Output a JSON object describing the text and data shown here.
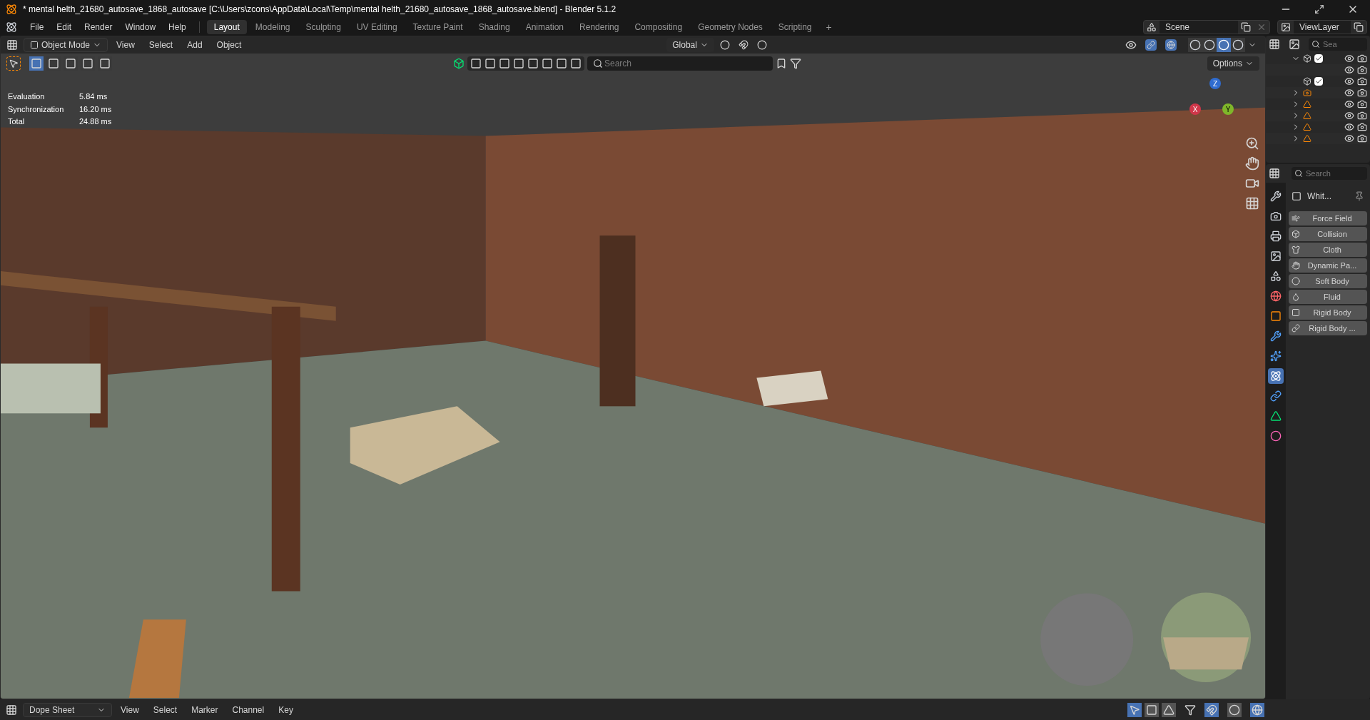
{
  "window": {
    "title": "* mental helth_21680_autosave_1868_autosave [C:\\Users\\zcons\\AppData\\Local\\Temp\\mental helth_21680_autosave_1868_autosave.blend] - Blender 5.1.2"
  },
  "menu": [
    "File",
    "Edit",
    "Render",
    "Window",
    "Help"
  ],
  "workspaces": [
    {
      "label": "Layout",
      "selected": true
    },
    {
      "label": "Modeling",
      "selected": false
    },
    {
      "label": "Sculpting",
      "selected": false
    },
    {
      "label": "UV Editing",
      "selected": false
    },
    {
      "label": "Texture Paint",
      "selected": false
    },
    {
      "label": "Shading",
      "selected": false
    },
    {
      "label": "Animation",
      "selected": false
    },
    {
      "label": "Rendering",
      "selected": false
    },
    {
      "label": "Compositing",
      "selected": false
    },
    {
      "label": "Geometry Nodes",
      "selected": false
    },
    {
      "label": "Scripting",
      "selected": false
    }
  ],
  "add_workspace": "+",
  "scene": "Scene",
  "view_layer": "ViewLayer",
  "viewport": {
    "mode": "Object Mode",
    "menus": [
      "View",
      "Select",
      "Add",
      "Object"
    ],
    "orientation": "Global",
    "search": {
      "placeholder": "Search"
    },
    "options": "Options",
    "select_modes": [
      {
        "selected": true
      },
      {
        "selected": false
      },
      {
        "selected": false
      },
      {
        "selected": false
      },
      {
        "selected": false
      }
    ],
    "shading": [
      {
        "selected": false
      },
      {
        "selected": false
      },
      {
        "selected": true
      },
      {
        "selected": false
      }
    ],
    "stats": [
      {
        "label": "Evaluation",
        "value": "5.84 ms"
      },
      {
        "label": "Synchronization",
        "value": "16.20 ms"
      },
      {
        "label": "Total",
        "value": "24.88 ms"
      }
    ],
    "gizmo": [
      "X",
      "Y",
      "Z"
    ]
  },
  "outliner": {
    "search": {
      "placeholder": "Sea"
    },
    "rows": [
      {
        "kind": "collection",
        "expanded": true,
        "checked": true
      },
      {
        "kind": "line"
      },
      {
        "kind": "collection",
        "checked": true
      },
      {
        "kind": "camera",
        "expanded": false
      },
      {
        "kind": "object",
        "expanded": false
      },
      {
        "kind": "object",
        "expanded": false
      },
      {
        "kind": "object",
        "expanded": false
      },
      {
        "kind": "object",
        "expanded": false
      }
    ]
  },
  "properties": {
    "search": {
      "placeholder": "Search"
    },
    "object": "Whit...",
    "tabs": [
      {
        "selected": false
      },
      {
        "selected": false
      },
      {
        "selected": false
      },
      {
        "selected": false
      },
      {
        "selected": false
      },
      {
        "selected": false
      },
      {
        "selected": false
      },
      {
        "selected": false
      },
      {
        "selected": false
      },
      {
        "selected": true
      },
      {
        "selected": false
      },
      {
        "selected": false
      },
      {
        "selected": false
      }
    ],
    "physics": [
      "Force Field",
      "Collision",
      "Cloth",
      "Dynamic Pa...",
      "Soft Body",
      "Fluid",
      "Rigid Body",
      "Rigid Body ..."
    ]
  },
  "timeline": {
    "editor": "Dope Sheet",
    "menus": [
      "View",
      "Select",
      "Marker",
      "Channel",
      "Key"
    ]
  }
}
